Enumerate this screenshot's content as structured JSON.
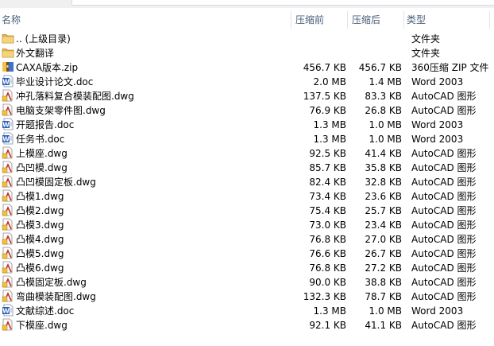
{
  "header": {
    "name": "名称",
    "original_size": "压缩前",
    "compressed_size": "压缩后",
    "type": "类型"
  },
  "files": [
    {
      "icon": "folder-up-icon",
      "name": ".. (上级目录)",
      "original": "",
      "compressed": "",
      "type": "文件夹"
    },
    {
      "icon": "folder-icon",
      "name": "外文翻译",
      "original": "",
      "compressed": "",
      "type": "文件夹"
    },
    {
      "icon": "zip-icon",
      "name": "CAXA版本.zip",
      "original": "456.7 KB",
      "compressed": "456.7 KB",
      "type": "360压缩 ZIP 文件"
    },
    {
      "icon": "word-icon",
      "name": "毕业设计论文.doc",
      "original": "2.0 MB",
      "compressed": "1.4 MB",
      "type": "Word 2003"
    },
    {
      "icon": "dwg-icon",
      "name": "冲孔落料复合模装配图.dwg",
      "original": "137.5 KB",
      "compressed": "83.3 KB",
      "type": "AutoCAD 图形"
    },
    {
      "icon": "dwg-icon",
      "name": "电脑支架零件图.dwg",
      "original": "76.9 KB",
      "compressed": "26.8 KB",
      "type": "AutoCAD 图形"
    },
    {
      "icon": "word-icon",
      "name": "开题报告.doc",
      "original": "1.3 MB",
      "compressed": "1.0 MB",
      "type": "Word 2003"
    },
    {
      "icon": "word-icon",
      "name": "任务书.doc",
      "original": "1.3 MB",
      "compressed": "1.0 MB",
      "type": "Word 2003"
    },
    {
      "icon": "dwg-icon",
      "name": "上模座.dwg",
      "original": "92.5 KB",
      "compressed": "41.4 KB",
      "type": "AutoCAD 图形"
    },
    {
      "icon": "dwg-icon",
      "name": "凸凹模.dwg",
      "original": "85.7 KB",
      "compressed": "35.8 KB",
      "type": "AutoCAD 图形"
    },
    {
      "icon": "dwg-icon",
      "name": "凸凹模固定板.dwg",
      "original": "82.4 KB",
      "compressed": "32.8 KB",
      "type": "AutoCAD 图形"
    },
    {
      "icon": "dwg-icon",
      "name": "凸模1.dwg",
      "original": "73.4 KB",
      "compressed": "23.6 KB",
      "type": "AutoCAD 图形"
    },
    {
      "icon": "dwg-icon",
      "name": "凸模2.dwg",
      "original": "75.4 KB",
      "compressed": "25.7 KB",
      "type": "AutoCAD 图形"
    },
    {
      "icon": "dwg-icon",
      "name": "凸模3.dwg",
      "original": "73.0 KB",
      "compressed": "23.4 KB",
      "type": "AutoCAD 图形"
    },
    {
      "icon": "dwg-icon",
      "name": "凸模4.dwg",
      "original": "76.8 KB",
      "compressed": "27.0 KB",
      "type": "AutoCAD 图形"
    },
    {
      "icon": "dwg-icon",
      "name": "凸模5.dwg",
      "original": "76.6 KB",
      "compressed": "26.7 KB",
      "type": "AutoCAD 图形"
    },
    {
      "icon": "dwg-icon",
      "name": "凸模6.dwg",
      "original": "76.8 KB",
      "compressed": "27.2 KB",
      "type": "AutoCAD 图形"
    },
    {
      "icon": "dwg-icon",
      "name": "凸模固定板.dwg",
      "original": "90.0 KB",
      "compressed": "38.8 KB",
      "type": "AutoCAD 图形"
    },
    {
      "icon": "dwg-icon",
      "name": "弯曲模装配图.dwg",
      "original": "132.3 KB",
      "compressed": "78.7 KB",
      "type": "AutoCAD 图形"
    },
    {
      "icon": "word-icon",
      "name": "文献综述.doc",
      "original": "1.3 MB",
      "compressed": "1.0 MB",
      "type": "Word 2003"
    },
    {
      "icon": "dwg-icon",
      "name": "下模座.dwg",
      "original": "92.1 KB",
      "compressed": "41.1 KB",
      "type": "AutoCAD 图形"
    }
  ]
}
